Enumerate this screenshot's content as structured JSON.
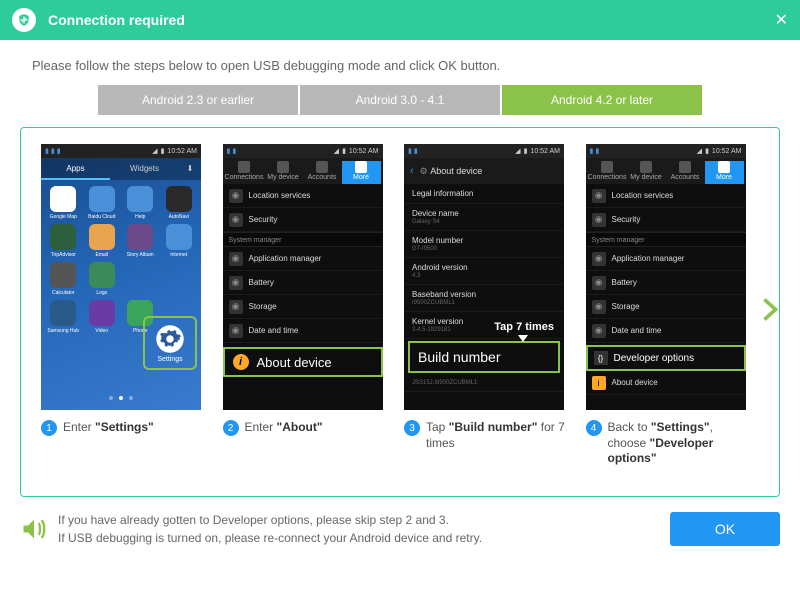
{
  "titlebar": {
    "title": "Connection required"
  },
  "instruction": "Please follow the steps below to open USB debugging mode and click OK button.",
  "tabs": [
    "Android 2.3 or earlier",
    "Android 3.0 - 4.1",
    "Android 4.2 or later"
  ],
  "active_tab": 2,
  "statusbar_time": "10:52 AM",
  "phone1": {
    "tabs": [
      "Apps",
      "Widgets"
    ],
    "icons": [
      {
        "label": "Google Map",
        "color": "#fff"
      },
      {
        "label": "Baidu Cloud",
        "color": "#4a90d9"
      },
      {
        "label": "Help",
        "color": "#4a90d9"
      },
      {
        "label": "AutoNavi",
        "color": "#2a2a2a"
      },
      {
        "label": "TripAdvisor",
        "color": "#2d5f3f"
      },
      {
        "label": "Email",
        "color": "#e8a54e"
      },
      {
        "label": "Story Album",
        "color": "#6a4a8a"
      },
      {
        "label": "Internet",
        "color": "#4a90d9"
      },
      {
        "label": "Calculator",
        "color": "#555"
      },
      {
        "label": "Logs",
        "color": "#3a8a5a"
      },
      {
        "label": "",
        "color": "transparent"
      },
      {
        "label": "",
        "color": "transparent"
      },
      {
        "label": "Samsung Hub",
        "color": "#2a5a8a"
      },
      {
        "label": "Video",
        "color": "#6a3aa5"
      },
      {
        "label": "Phone",
        "color": "#3aa55a"
      }
    ],
    "settings_label": "Settings"
  },
  "phone2": {
    "header_tabs": [
      "Connections",
      "My device",
      "Accounts",
      "More"
    ],
    "items": [
      {
        "section": "",
        "label": "Location services"
      },
      {
        "section": "",
        "label": "Security"
      },
      {
        "section": "System manager",
        "label": "Application manager"
      },
      {
        "section": "",
        "label": "Battery"
      },
      {
        "section": "",
        "label": "Storage"
      },
      {
        "section": "",
        "label": "Date and time"
      }
    ],
    "about_label": "About device"
  },
  "phone3": {
    "header": "About device",
    "rows": [
      {
        "k": "Legal information",
        "v": ""
      },
      {
        "k": "Device name",
        "v": "Galaxy S4"
      },
      {
        "k": "Model number",
        "v": "GT-I9500"
      },
      {
        "k": "Android version",
        "v": "4.3"
      },
      {
        "k": "Baseband version",
        "v": "I9500ZCUBML1"
      },
      {
        "k": "Kernel version",
        "v": "3.4.5-1929181"
      }
    ],
    "tap_label": "Tap 7 times",
    "build_label": "Build number"
  },
  "phone4": {
    "header_tabs": [
      "Connections",
      "My device",
      "Accounts",
      "More"
    ],
    "items": [
      {
        "section": "",
        "label": "Location services"
      },
      {
        "section": "",
        "label": "Security"
      },
      {
        "section": "System manager",
        "label": "Application manager"
      },
      {
        "section": "",
        "label": "Battery"
      },
      {
        "section": "",
        "label": "Storage"
      },
      {
        "section": "",
        "label": "Date and time"
      }
    ],
    "dev_label": "Developer options",
    "about_item": "About device"
  },
  "captions": [
    {
      "html": "Enter <b>\"Settings\"</b>"
    },
    {
      "html": "Enter <b>\"About\"</b>"
    },
    {
      "html": "Tap <b>\"Build number\"</b> for 7 times"
    },
    {
      "html": "Back to <b>\"Settings\"</b>, choose <b>\"Developer options\"</b>"
    }
  ],
  "footer": {
    "line1": "If you have already gotten to Developer options, please skip step 2 and 3.",
    "line2": "If USB debugging is turned on, please re-connect your Android device and retry.",
    "ok": "OK"
  }
}
